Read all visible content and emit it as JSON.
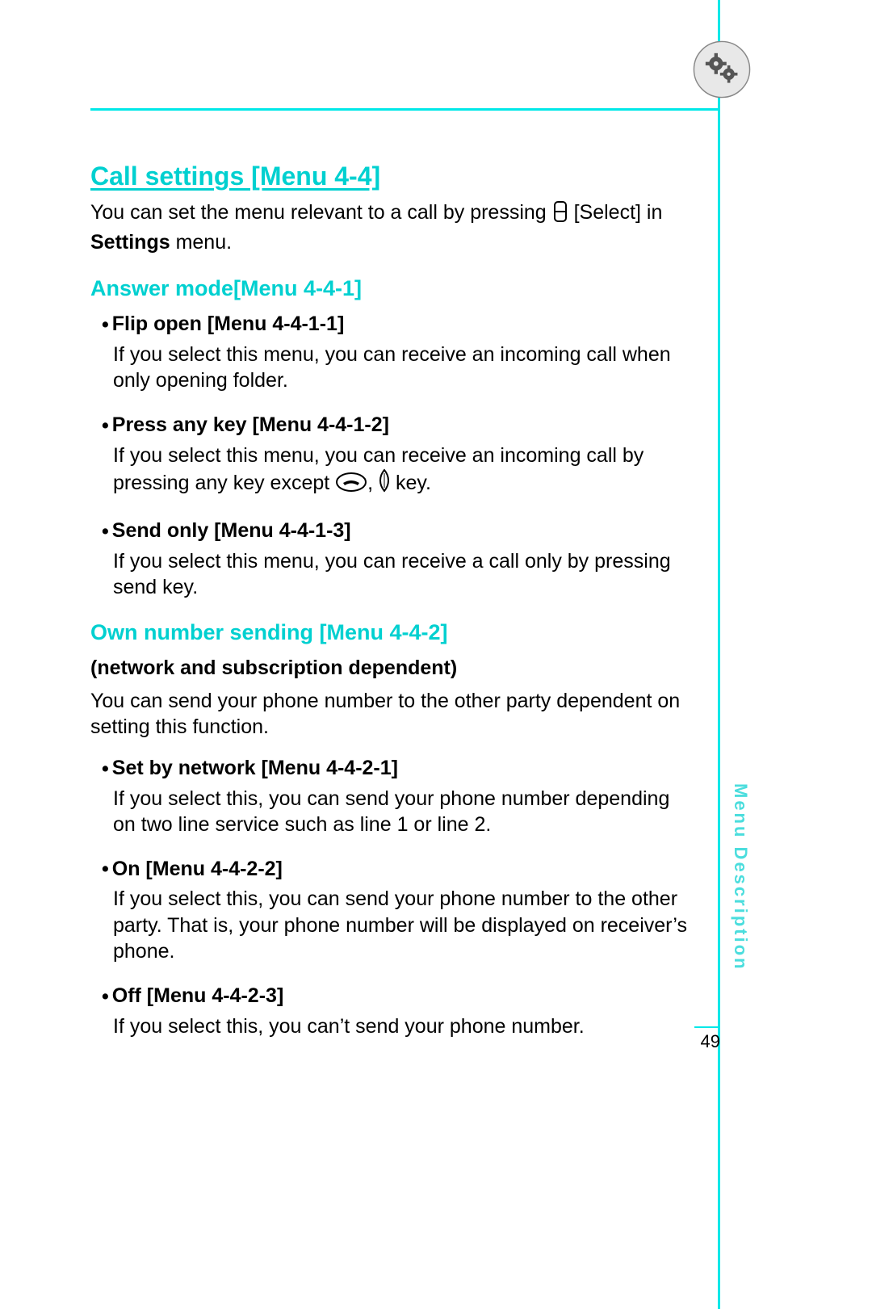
{
  "page_number": "49",
  "side_text": "Menu Description",
  "title": "Call settings [Menu 4-4]",
  "intro_part1": "You can set the menu relevant to a call by pressing ",
  "intro_select": " [Select] in ",
  "intro_settings_bold": "Settings",
  "intro_menu_suffix": " menu.",
  "answer_mode": {
    "heading": "Answer mode[Menu 4-4-1]",
    "flip_open": {
      "title": "Flip open [Menu 4-4-1-1]",
      "body": "If you select this menu, you can receive an incoming call when only opening folder."
    },
    "press_any_key": {
      "title": "Press any key [Menu 4-4-1-2]",
      "body_a": "If you select this menu, you can receive an incoming call by pressing any key except ",
      "body_b": ", ",
      "body_c": " key."
    },
    "send_only": {
      "title": "Send only [Menu 4-4-1-3]",
      "body": "If you select this menu, you can receive a call only by pressing send key."
    }
  },
  "own_number": {
    "heading": "Own number sending [Menu 4-4-2]",
    "note": "(network and subscription dependent)",
    "intro": "You can send your phone number to the other party dependent on setting this function.",
    "set_by_network": {
      "title": "Set by network [Menu 4-4-2-1]",
      "body": "If you select this, you can send your phone  number depending on two line service such as line 1 or line 2."
    },
    "on": {
      "title": "On [Menu 4-4-2-2]",
      "body": "If you select this, you can send your phone number to the other party. That is, your phone number will be displayed on receiver’s phone."
    },
    "off": {
      "title": "Off [Menu 4-4-2-3]",
      "body": "If you select this, you can’t send your phone number."
    }
  }
}
